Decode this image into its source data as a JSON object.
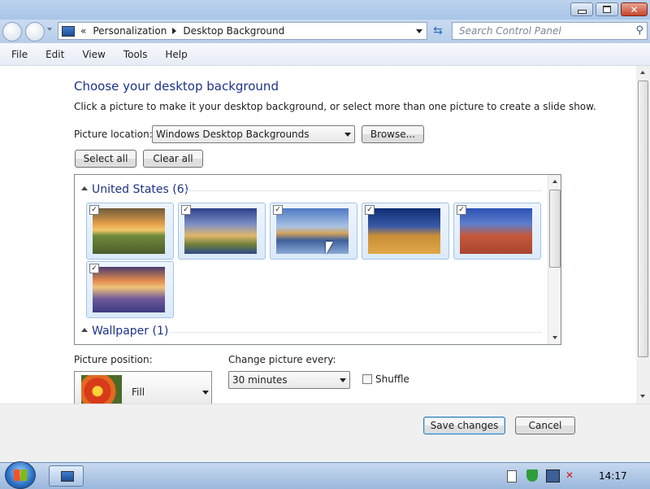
{
  "window": {
    "caption_buttons": [
      "minimize-icon",
      "maximize-icon",
      "close-icon"
    ]
  },
  "nav": {
    "breadcrumb_prefix": "«",
    "breadcrumb": [
      "Personalization",
      "Desktop Background"
    ],
    "search_placeholder": "Search Control Panel"
  },
  "menu": [
    "File",
    "Edit",
    "View",
    "Tools",
    "Help"
  ],
  "main": {
    "title": "Choose your desktop background",
    "subtitle": "Click a picture to make it your desktop background, or select more than one picture to create a slide show.",
    "picture_location_label": "Picture location:",
    "picture_location_value": "Windows Desktop Backgrounds",
    "browse_label": "Browse...",
    "select_all_label": "Select all",
    "clear_all_label": "Clear all"
  },
  "gallery": {
    "groups": [
      {
        "name": "United States (6)",
        "items": [
          {
            "name": "sunset-prairie",
            "checked": true
          },
          {
            "name": "lighthouse-coast",
            "checked": true
          },
          {
            "name": "rock-lake",
            "checked": true
          },
          {
            "name": "hay-bale",
            "checked": true
          },
          {
            "name": "delicate-arch",
            "checked": true
          },
          {
            "name": "lupine-field",
            "checked": true
          }
        ]
      },
      {
        "name": "Wallpaper (1)",
        "items": []
      }
    ]
  },
  "position": {
    "label": "Picture position:",
    "value": "Fill"
  },
  "interval": {
    "label": "Change picture every:",
    "value": "30 minutes"
  },
  "shuffle": {
    "label": "Shuffle",
    "checked": false
  },
  "footer": {
    "save_label": "Save changes",
    "cancel_label": "Cancel"
  },
  "taskbar": {
    "time": "14:17"
  }
}
